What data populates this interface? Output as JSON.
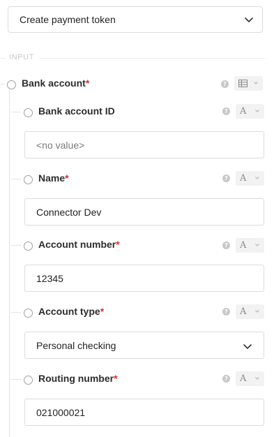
{
  "action": {
    "selected": "Create payment token"
  },
  "section": {
    "label": "INPUT"
  },
  "parent": {
    "label": "Bank account",
    "required_mark": "*"
  },
  "fields": [
    {
      "label": "Bank account ID",
      "required_mark": "",
      "value": "<no value>",
      "is_placeholder": true,
      "type_icon": "A"
    },
    {
      "label": "Name",
      "required_mark": "*",
      "value": "Connector Dev",
      "type_icon": "A"
    },
    {
      "label": "Account number",
      "required_mark": "*",
      "value": "12345",
      "type_icon": "A"
    },
    {
      "label": "Account type",
      "required_mark": "*",
      "value": "Personal checking",
      "is_dropdown": true,
      "type_icon": "A"
    },
    {
      "label": "Routing number",
      "required_mark": "*",
      "value": "021000021",
      "type_icon": "A"
    }
  ],
  "icons": {
    "help": "?",
    "chevron": "chevron-down-icon",
    "table": "table-icon"
  },
  "colors": {
    "required": "#d0342c",
    "border": "#dcdcdc",
    "muted": "#c9c9c9"
  }
}
